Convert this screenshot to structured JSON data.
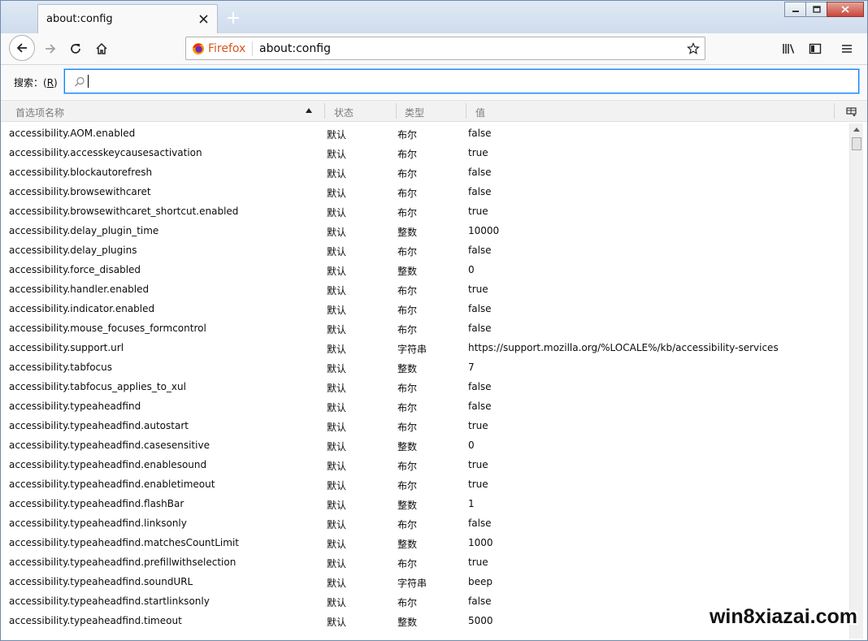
{
  "tab": {
    "title": "about:config"
  },
  "navbar": {
    "identity_label": "Firefox",
    "url": "about:config"
  },
  "search": {
    "label_prefix": "搜索：(",
    "label_key": "R",
    "label_suffix": ")",
    "value": "",
    "placeholder": ""
  },
  "table": {
    "headers": {
      "name": "首选项名称",
      "status": "状态",
      "type": "类型",
      "value": "值"
    },
    "rows": [
      {
        "name": "accessibility.AOM.enabled",
        "status": "默认",
        "type": "布尔",
        "value": "false"
      },
      {
        "name": "accessibility.accesskeycausesactivation",
        "status": "默认",
        "type": "布尔",
        "value": "true"
      },
      {
        "name": "accessibility.blockautorefresh",
        "status": "默认",
        "type": "布尔",
        "value": "false"
      },
      {
        "name": "accessibility.browsewithcaret",
        "status": "默认",
        "type": "布尔",
        "value": "false"
      },
      {
        "name": "accessibility.browsewithcaret_shortcut.enabled",
        "status": "默认",
        "type": "布尔",
        "value": "true"
      },
      {
        "name": "accessibility.delay_plugin_time",
        "status": "默认",
        "type": "整数",
        "value": "10000"
      },
      {
        "name": "accessibility.delay_plugins",
        "status": "默认",
        "type": "布尔",
        "value": "false"
      },
      {
        "name": "accessibility.force_disabled",
        "status": "默认",
        "type": "整数",
        "value": "0"
      },
      {
        "name": "accessibility.handler.enabled",
        "status": "默认",
        "type": "布尔",
        "value": "true"
      },
      {
        "name": "accessibility.indicator.enabled",
        "status": "默认",
        "type": "布尔",
        "value": "false"
      },
      {
        "name": "accessibility.mouse_focuses_formcontrol",
        "status": "默认",
        "type": "布尔",
        "value": "false"
      },
      {
        "name": "accessibility.support.url",
        "status": "默认",
        "type": "字符串",
        "value": "https://support.mozilla.org/%LOCALE%/kb/accessibility-services"
      },
      {
        "name": "accessibility.tabfocus",
        "status": "默认",
        "type": "整数",
        "value": "7"
      },
      {
        "name": "accessibility.tabfocus_applies_to_xul",
        "status": "默认",
        "type": "布尔",
        "value": "false"
      },
      {
        "name": "accessibility.typeaheadfind",
        "status": "默认",
        "type": "布尔",
        "value": "false"
      },
      {
        "name": "accessibility.typeaheadfind.autostart",
        "status": "默认",
        "type": "布尔",
        "value": "true"
      },
      {
        "name": "accessibility.typeaheadfind.casesensitive",
        "status": "默认",
        "type": "整数",
        "value": "0"
      },
      {
        "name": "accessibility.typeaheadfind.enablesound",
        "status": "默认",
        "type": "布尔",
        "value": "true"
      },
      {
        "name": "accessibility.typeaheadfind.enabletimeout",
        "status": "默认",
        "type": "布尔",
        "value": "true"
      },
      {
        "name": "accessibility.typeaheadfind.flashBar",
        "status": "默认",
        "type": "整数",
        "value": "1"
      },
      {
        "name": "accessibility.typeaheadfind.linksonly",
        "status": "默认",
        "type": "布尔",
        "value": "false"
      },
      {
        "name": "accessibility.typeaheadfind.matchesCountLimit",
        "status": "默认",
        "type": "整数",
        "value": "1000"
      },
      {
        "name": "accessibility.typeaheadfind.prefillwithselection",
        "status": "默认",
        "type": "布尔",
        "value": "true"
      },
      {
        "name": "accessibility.typeaheadfind.soundURL",
        "status": "默认",
        "type": "字符串",
        "value": "beep"
      },
      {
        "name": "accessibility.typeaheadfind.startlinksonly",
        "status": "默认",
        "type": "布尔",
        "value": "false"
      },
      {
        "name": "accessibility.typeaheadfind.timeout",
        "status": "默认",
        "type": "整数",
        "value": "5000"
      }
    ]
  },
  "watermark": "win8xiazai.com",
  "colors": {
    "accent": "#0a84ff",
    "firefox_orange": "#d7561f",
    "close_red": "#c8473a"
  },
  "icons": [
    "close-icon",
    "plus-icon",
    "minimize-icon",
    "restore-icon",
    "back-arrow-icon",
    "forward-arrow-icon",
    "reload-icon",
    "home-icon",
    "firefox-logo-icon",
    "star-icon",
    "library-icon",
    "sidebar-icon",
    "menu-icon",
    "search-icon",
    "column-picker-icon"
  ]
}
